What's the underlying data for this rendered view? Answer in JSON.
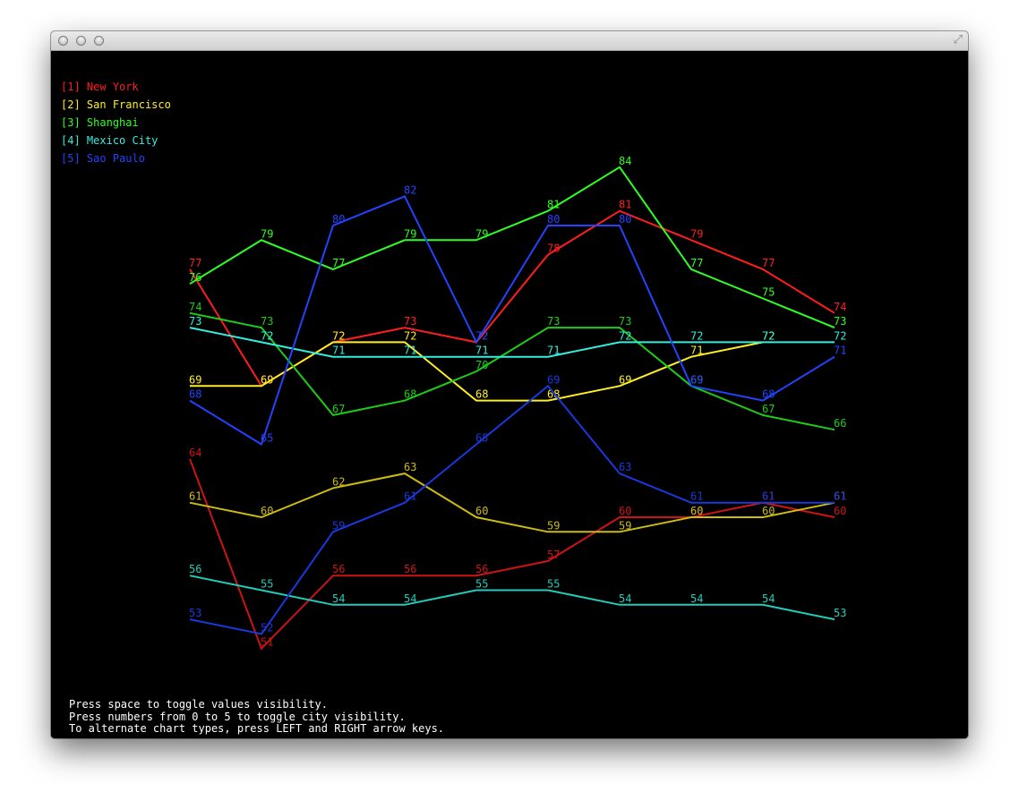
{
  "window": {
    "buttons": [
      "close",
      "minimize",
      "zoom"
    ],
    "resize_icon": "fullscreen-arrows-icon"
  },
  "legend": [
    {
      "key": "[1]",
      "label": "New York",
      "color": "#ff1e1e"
    },
    {
      "key": "[2]",
      "label": "San Francisco",
      "color": "#ffee22"
    },
    {
      "key": "[3]",
      "label": "Shanghai",
      "color": "#2eff22"
    },
    {
      "key": "[4]",
      "label": "Mexico City",
      "color": "#33eedd"
    },
    {
      "key": "[5]",
      "label": "Sao Paulo",
      "color": "#2244ff"
    }
  ],
  "help": [
    "Press space to toggle values visibility.",
    "Press numbers from 0 to 5 to toggle city visibility.",
    "To alternate chart types, press LEFT and RIGHT arrow keys."
  ],
  "chart_data": {
    "type": "line",
    "x": [
      1,
      2,
      3,
      4,
      5,
      6,
      7,
      8,
      9,
      10
    ],
    "ylim": [
      50,
      85
    ],
    "grid": false,
    "legend_position": "top-left",
    "series": [
      {
        "name": "New York",
        "band": "high",
        "color": "#ff1e1e",
        "values": [
          77,
          69,
          72,
          73,
          72,
          78,
          81,
          79,
          77,
          74
        ]
      },
      {
        "name": "New York",
        "band": "low",
        "color": "#cc1414",
        "values": [
          64,
          51,
          56,
          56,
          56,
          57,
          60,
          60,
          61,
          60
        ]
      },
      {
        "name": "San Francisco",
        "band": "high",
        "color": "#ffee22",
        "values": [
          69,
          69,
          72,
          72,
          68,
          68,
          69,
          71,
          72,
          null
        ]
      },
      {
        "name": "San Francisco",
        "band": "low",
        "color": "#ccbb11",
        "values": [
          61,
          60,
          62,
          63,
          60,
          59,
          59,
          60,
          60,
          61
        ]
      },
      {
        "name": "Shanghai",
        "band": "high",
        "color": "#2eff22",
        "values": [
          76,
          79,
          77,
          79,
          79,
          81,
          84,
          77,
          75,
          73
        ]
      },
      {
        "name": "Shanghai",
        "band": "low",
        "color": "#1ecc18",
        "values": [
          74,
          73,
          67,
          68,
          70,
          73,
          73,
          69,
          67,
          66
        ]
      },
      {
        "name": "Mexico City",
        "band": "high",
        "color": "#33eedd",
        "values": [
          73,
          72,
          71,
          71,
          71,
          71,
          72,
          72,
          72,
          72
        ]
      },
      {
        "name": "Mexico City",
        "band": "low",
        "color": "#22ccbb",
        "values": [
          56,
          55,
          54,
          54,
          55,
          55,
          54,
          54,
          54,
          53
        ]
      },
      {
        "name": "Sao Paulo",
        "band": "high",
        "color": "#2244ff",
        "values": [
          68,
          65,
          80,
          82,
          72,
          80,
          80,
          69,
          68,
          71
        ]
      },
      {
        "name": "Sao Paulo",
        "band": "low",
        "color": "#1a38dd",
        "values": [
          53,
          52,
          59,
          61,
          65,
          69,
          63,
          61,
          61,
          61
        ]
      }
    ]
  }
}
